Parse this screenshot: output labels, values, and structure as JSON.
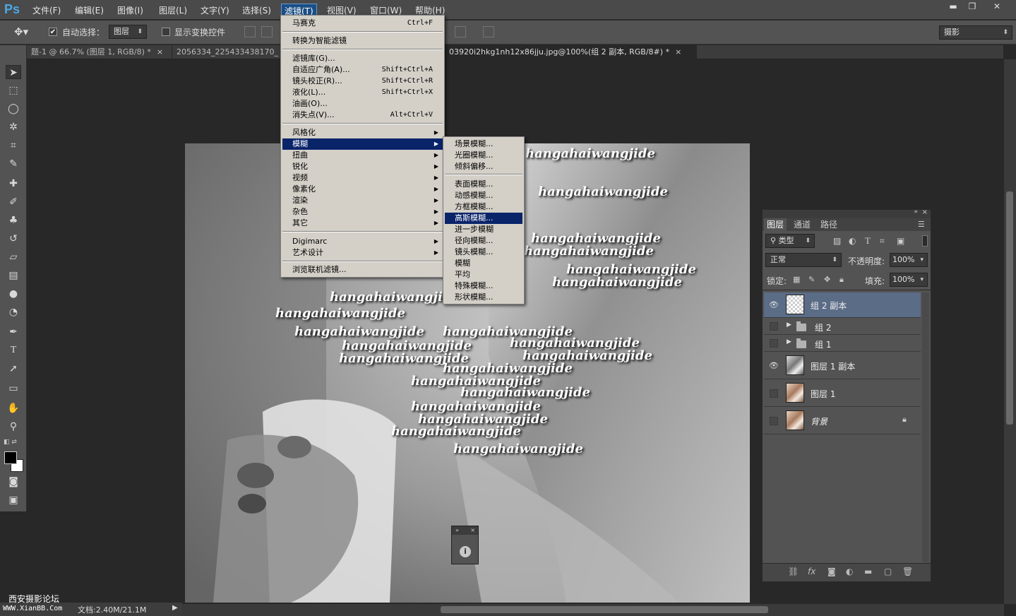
{
  "app": {
    "logo": "Ps"
  },
  "menubar": {
    "items": [
      "文件(F)",
      "编辑(E)",
      "图像(I)",
      "图层(L)",
      "文字(Y)",
      "选择(S)",
      "滤镜(T)",
      "视图(V)",
      "窗口(W)",
      "帮助(H)"
    ],
    "active_index": 6
  },
  "window_controls": {
    "minimize": "▬",
    "restore": "❐",
    "close": "✕"
  },
  "options": {
    "auto_select_label": "自动选择：",
    "auto_select_checked": true,
    "auto_select_target": "图层",
    "show_transform_label": "显示变换控件",
    "show_transform_checked": false,
    "workspace": "摄影"
  },
  "tabs": [
    {
      "label": "题-1 @ 66.7% (图层 1, RGB/8) *",
      "close": "×"
    },
    {
      "label": "2056334_225433438170_",
      "close": ""
    },
    {
      "label": "03920i2hkg1nh12x86jju.jpg@100%(组 2 副本, RGB/8#) *",
      "close": "×"
    }
  ],
  "filter_menu": {
    "top": [
      {
        "label": "马赛克",
        "shortcut": "Ctrl+F"
      }
    ],
    "smart": [
      {
        "label": "转换为智能滤镜"
      }
    ],
    "gallery": [
      {
        "label": "滤镜库(G)...",
        "shortcut": ""
      },
      {
        "label": "自适应广角(A)...",
        "shortcut": "Shift+Ctrl+A"
      },
      {
        "label": "镜头校正(R)...",
        "shortcut": "Shift+Ctrl+R"
      },
      {
        "label": "液化(L)...",
        "shortcut": "Shift+Ctrl+X"
      },
      {
        "label": "油画(O)...",
        "shortcut": ""
      },
      {
        "label": "消失点(V)...",
        "shortcut": "Alt+Ctrl+V"
      }
    ],
    "groups": [
      "风格化",
      "模糊",
      "扭曲",
      "锐化",
      "视频",
      "像素化",
      "渲染",
      "杂色",
      "其它"
    ],
    "highlighted_group": "模糊",
    "plugins": [
      "Digimarc",
      "艺术设计"
    ],
    "browse": "浏览联机滤镜..."
  },
  "blur_menu": {
    "items": [
      "场景模糊...",
      "光圈模糊...",
      "倾斜偏移...",
      "表面模糊...",
      "动感模糊...",
      "方框模糊...",
      "高斯模糊...",
      "进一步模糊",
      "径向模糊...",
      "镜头模糊...",
      "模糊",
      "平均",
      "特殊模糊...",
      "形状模糊..."
    ],
    "highlighted": "高斯模糊..."
  },
  "canvas": {
    "watermark_text": "hangahaiwangjide"
  },
  "layers_panel": {
    "tabs": [
      "图层",
      "通道",
      "路径"
    ],
    "filter_kind": "类型",
    "blend_mode": "正常",
    "opacity_label": "不透明度:",
    "opacity": "100%",
    "lock_label": "锁定:",
    "fill_label": "填充:",
    "fill": "100%",
    "layers": [
      {
        "name": "组 2 副本",
        "visible": true,
        "kind": "layer-empty",
        "selected": true
      },
      {
        "name": "组 2",
        "visible": false,
        "kind": "group"
      },
      {
        "name": "组 1",
        "visible": false,
        "kind": "group"
      },
      {
        "name": "图层 1 副本",
        "visible": true,
        "kind": "layer-gray"
      },
      {
        "name": "图层 1",
        "visible": false,
        "kind": "layer-color"
      },
      {
        "name": "背景",
        "visible": false,
        "kind": "background",
        "locked": true
      }
    ]
  },
  "status": {
    "forum": "西安摄影论坛",
    "url": "WWW.XianBB.Com",
    "doc": "文档:2.40M/21.1M"
  }
}
